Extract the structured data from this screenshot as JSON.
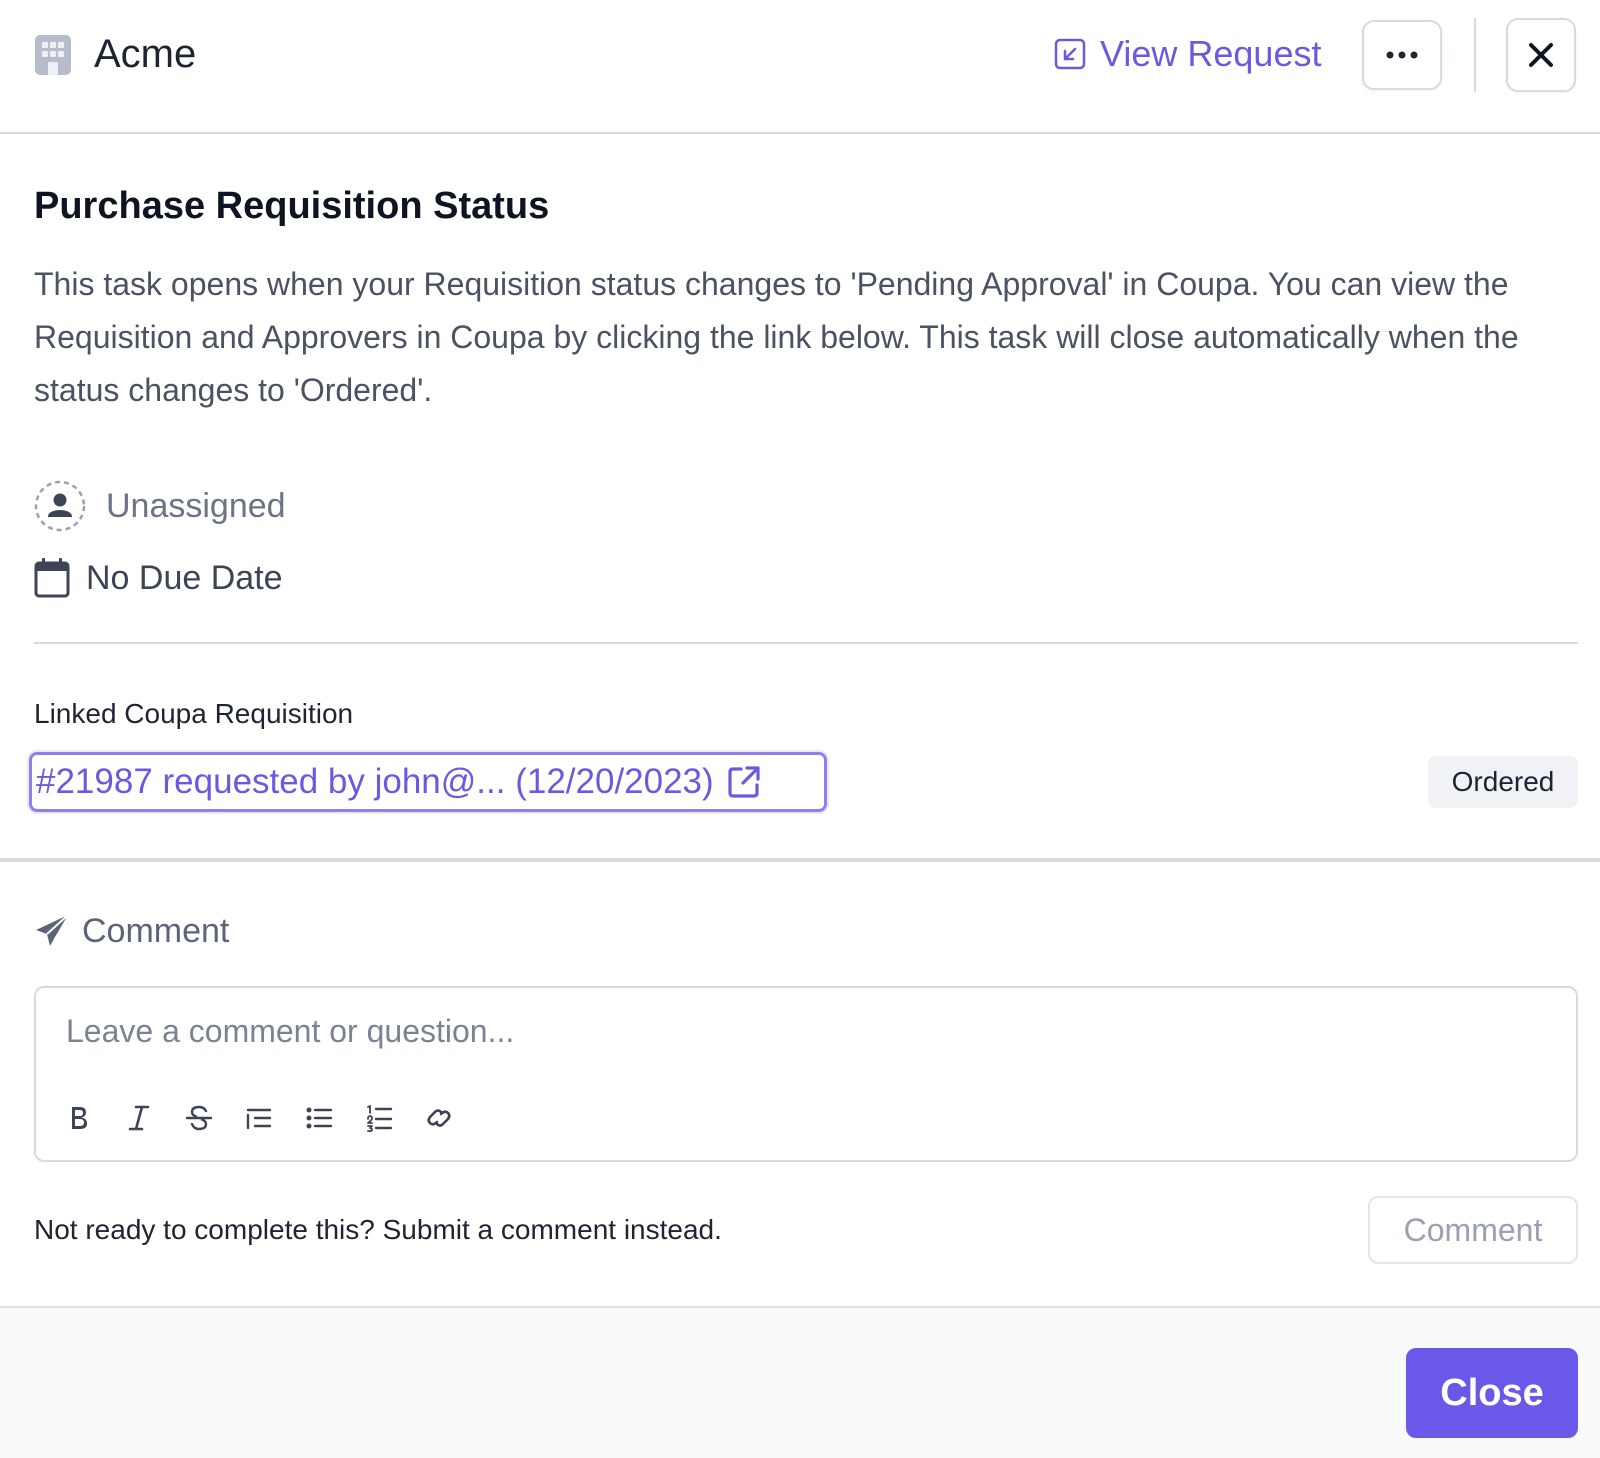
{
  "colors": {
    "accent": "#6a5ae0",
    "primary_button": "#6a58e8",
    "badge_bg": "#f0f2f6",
    "border": "#d6dae3"
  },
  "header": {
    "org_icon": "building-icon",
    "org_name": "Acme",
    "view_request_icon": "open-in-arrow-icon",
    "view_request_label": "View Request",
    "more_icon": "ellipsis-icon",
    "close_icon": "close-icon"
  },
  "task": {
    "title": "Purchase Requisition Status",
    "description": "This task opens when your Requisition status changes to 'Pending Approval' in Coupa. You can view the Requisition and Approvers in Coupa by clicking the link below. This task will close automatically when the status changes to 'Ordered'.",
    "assignee_icon": "user-circle-icon",
    "assignee": "Unassigned",
    "due_icon": "calendar-icon",
    "due_date": "No Due Date"
  },
  "linked": {
    "label": "Linked Coupa Requisition",
    "link_text": "#21987 requested by john@... (12/20/2023)",
    "link_icon": "external-link-icon",
    "status": "Ordered"
  },
  "comment": {
    "icon": "paper-plane-icon",
    "title": "Comment",
    "placeholder": "Leave a comment or question...",
    "toolbar": [
      "bold-icon",
      "italic-icon",
      "strikethrough-icon",
      "indent-icon",
      "bullet-list-icon",
      "numbered-list-icon",
      "link-icon"
    ],
    "hint": "Not ready to complete this? Submit a comment instead.",
    "submit_label": "Comment"
  },
  "footer": {
    "close_label": "Close"
  }
}
